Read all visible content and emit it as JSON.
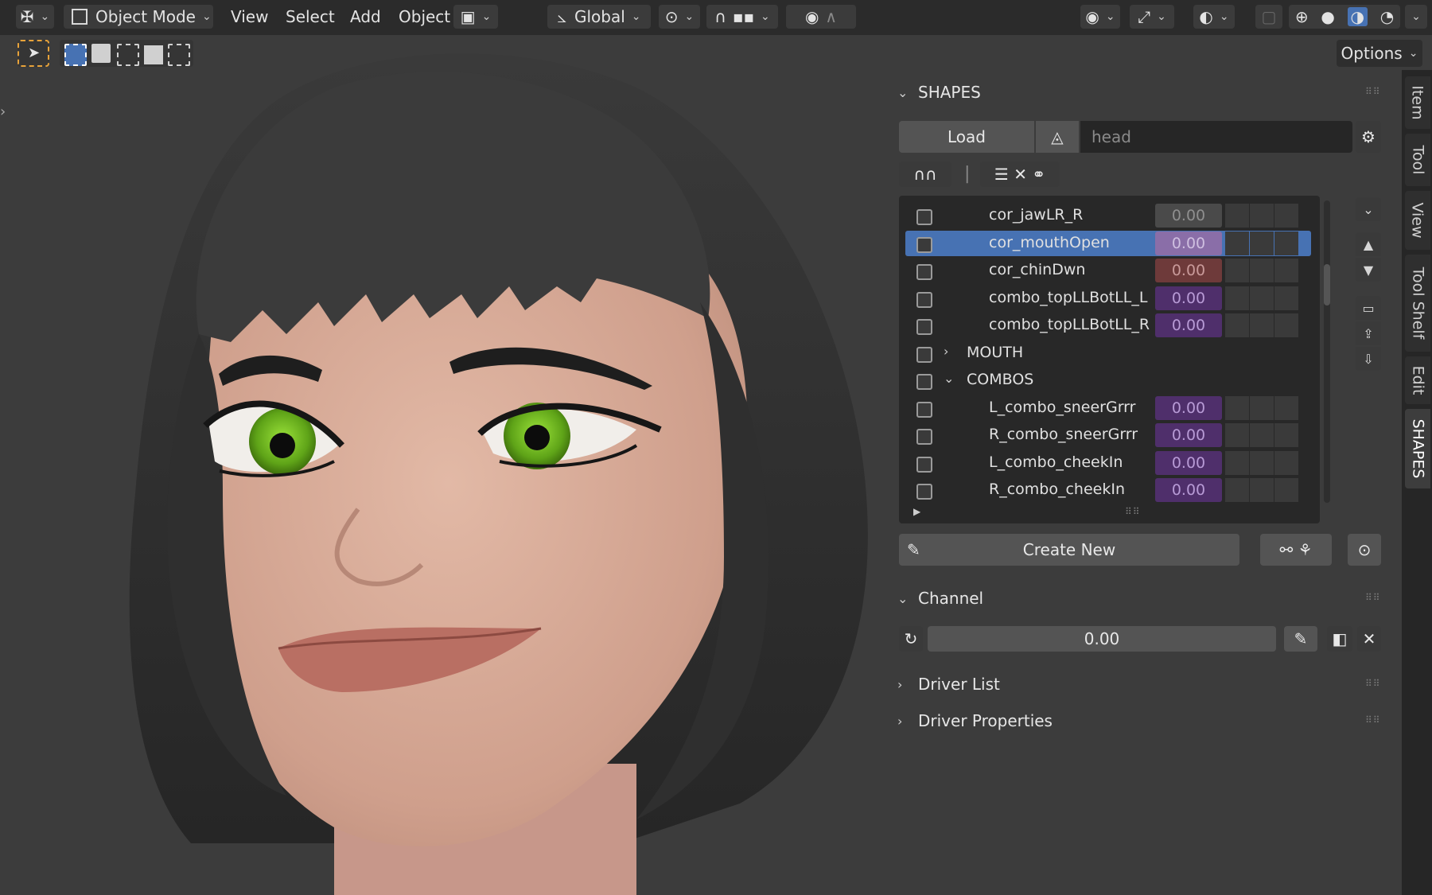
{
  "header": {
    "mode_label": "Object Mode",
    "menus": [
      "View",
      "Select",
      "Add",
      "Object"
    ],
    "transform_orientation": "Global",
    "options_label": "Options"
  },
  "shapes_panel": {
    "title": "SHAPES",
    "load_label": "Load",
    "mesh_placeholder": "head",
    "rows": [
      {
        "name": "cor_jawLR_R",
        "value": "0.00",
        "kind": "shape",
        "val_color": "#4a4a4a",
        "val_text": "#8f8f8f"
      },
      {
        "name": "cor_mouthOpen",
        "value": "0.00",
        "kind": "shape",
        "val_color": "#8a6ea8",
        "val_text": "#cfbfe0",
        "selected": true
      },
      {
        "name": "cor_chinDwn",
        "value": "0.00",
        "kind": "shape",
        "val_color": "#6e3a3a",
        "val_text": "#c99a9a"
      },
      {
        "name": "combo_topLLBotLL_L",
        "value": "0.00",
        "kind": "shape",
        "val_color": "#4f2f6b",
        "val_text": "#b89bd6"
      },
      {
        "name": "combo_topLLBotLL_R",
        "value": "0.00",
        "kind": "shape",
        "val_color": "#4f2f6b",
        "val_text": "#b89bd6"
      },
      {
        "name": "MOUTH",
        "kind": "group",
        "collapsed": true
      },
      {
        "name": "COMBOS",
        "kind": "group",
        "collapsed": false
      },
      {
        "name": "L_combo_sneerGrrr",
        "value": "0.00",
        "kind": "shape",
        "val_color": "#4f2f6b",
        "val_text": "#b89bd6"
      },
      {
        "name": "R_combo_sneerGrrr",
        "value": "0.00",
        "kind": "shape",
        "val_color": "#4f2f6b",
        "val_text": "#b89bd6"
      },
      {
        "name": "L_combo_cheekIn",
        "value": "0.00",
        "kind": "shape",
        "val_color": "#4f2f6b",
        "val_text": "#b89bd6"
      },
      {
        "name": "R_combo_cheekIn",
        "value": "0.00",
        "kind": "shape",
        "val_color": "#4f2f6b",
        "val_text": "#b89bd6"
      }
    ],
    "create_new_label": "Create New"
  },
  "channel_panel": {
    "title": "Channel",
    "value": "0.00"
  },
  "driver_list": {
    "title": "Driver List"
  },
  "driver_properties": {
    "title": "Driver Properties"
  },
  "side_tabs": [
    "Item",
    "Tool",
    "View",
    "Tool Shelf",
    "Edit",
    "SHAPES"
  ],
  "colors": {
    "selection": "#4772b3",
    "accent_orange": "#e8a33a"
  }
}
